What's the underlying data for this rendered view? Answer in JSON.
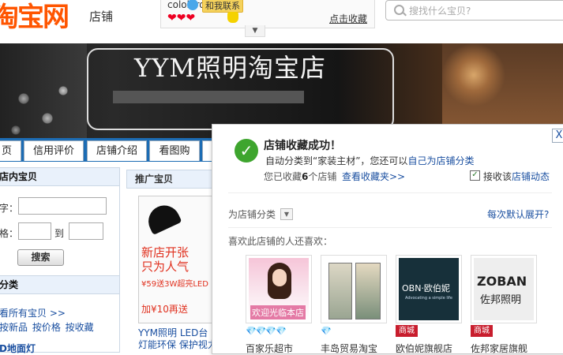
{
  "header": {
    "logo_text": "淘宝网",
    "logo_sub": "店铺",
    "seller_name": "colobird",
    "contact_label": "和我联系",
    "hearts": "❤❤❤",
    "favorite_link": "点击收藏",
    "dropdown_arrow": "▼",
    "search_placeholder": "搜找什么宝贝?"
  },
  "banner": {
    "title": "YYM照明淘宝店"
  },
  "nav": {
    "tabs": [
      "页",
      "信用评价",
      "店铺介绍",
      "看图购",
      ""
    ]
  },
  "sidebar": {
    "search_head": "店内宝贝",
    "keyword_label": "字：",
    "price_label": "格：",
    "price_to": "到",
    "search_button": "搜索",
    "category_head": "分类",
    "all_items_link": "看所有宝贝 >>",
    "sort_links": "按新品  按价格  按收藏",
    "category_item": "D地面灯"
  },
  "promo": {
    "head": "推广宝贝",
    "line1": "新店开张",
    "line2": "只为人气",
    "line3": "¥59送3W超亮LED",
    "line4": "加¥10再送",
    "caption": "YYM照明 LED台灯能环保 保护视力"
  },
  "popup": {
    "close": "X",
    "success_title": "店铺收藏成功！",
    "sub1_prefix": "自动分类到“家装主材”，您还可以",
    "sub1_link": "自己为店铺分类",
    "sub2_prefix": "您已收藏",
    "sub2_count": "6",
    "sub2_suffix": "个店铺",
    "view_fav_link": "查看收藏夹>>",
    "receive_check": "✓",
    "receive_prefix": "接收该",
    "receive_link": "店铺动态",
    "category_select": "为店铺分类",
    "category_arrow": "▼",
    "expand_link": "每次默认展开?",
    "expand_arrow": "▲",
    "also_like": "喜欢此店铺的人还喜欢：",
    "recommendations": [
      {
        "image_text": "欢迎光临本店",
        "badge": "💎💎💎💎",
        "name": "百家乐超市"
      },
      {
        "image_text": "",
        "badge": "💎",
        "name": "丰岛贸易淘宝"
      },
      {
        "image_text": "OBN·欧伯妮",
        "image_small": "Advocating a simple life",
        "badge": "商城",
        "name": "欧伯妮旗舰店"
      },
      {
        "image_text": "ZOBAN",
        "image_small": "佐邦照明",
        "badge": "商城",
        "name": "佐邦家居旗舰"
      }
    ]
  }
}
